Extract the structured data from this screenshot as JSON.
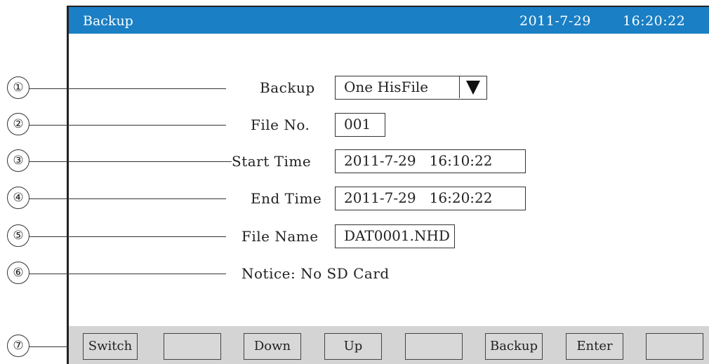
{
  "titlebar": {
    "title": "Backup",
    "date": "2011-7-29",
    "time": "16:20:22",
    "color": "#1a7fc4"
  },
  "callouts": [
    "①",
    "②",
    "③",
    "④",
    "⑤",
    "⑥",
    "⑦"
  ],
  "form": {
    "backup_label": "Backup",
    "backup_value": "One HisFile",
    "file_no_label": "File No.",
    "file_no_value": "001",
    "start_label": "Start Time",
    "start_value": "2011-7-29   16:10:22",
    "end_label": "End Time",
    "end_value": "2011-7-29   16:20:22",
    "filename_label": "File Name",
    "filename_value": "DAT0001.NHD",
    "notice": "Notice: No SD Card"
  },
  "softkeys": [
    "Switch",
    "",
    "Down",
    "Up",
    "",
    "Backup",
    "Enter",
    ""
  ],
  "icons": {
    "dropdown": "triangle-down-icon"
  }
}
